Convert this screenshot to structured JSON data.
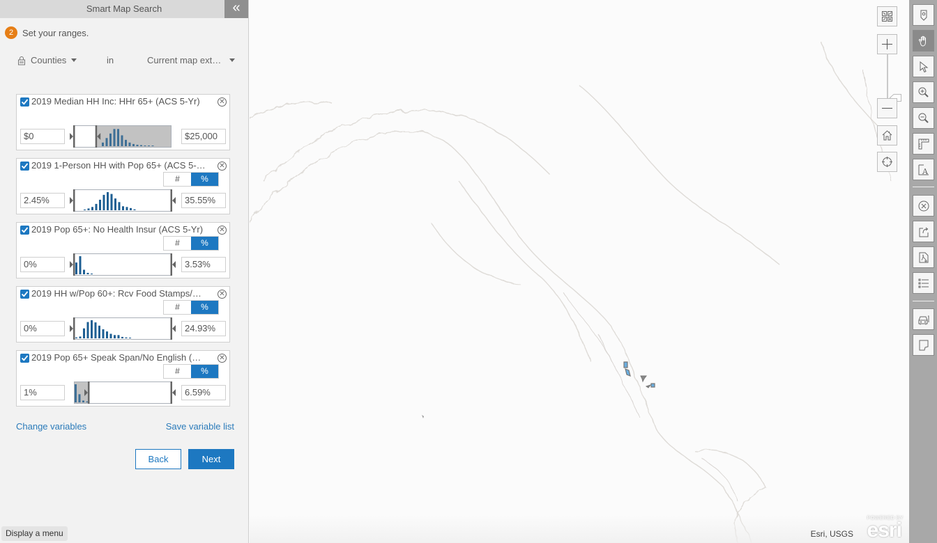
{
  "panel": {
    "title": "Smart Map Search",
    "collapse_icon": "double-chevron-left-icon",
    "step_number": "2",
    "step_text": "Set your ranges.",
    "geography_level": "Counties",
    "geography_connector": "in",
    "extent": "Current map ext…",
    "variables": [
      {
        "title": "2019 Median HH Inc: HHr 65+ (ACS 5-Yr)",
        "checked": true,
        "has_toggle": false,
        "min": "$0",
        "max": "$25,000",
        "selected_range_fraction": [
          0.0,
          0.23
        ],
        "histogram": [
          0.2,
          0.45,
          0.7,
          0.95,
          0.95,
          0.6,
          0.35,
          0.2,
          0.12,
          0.08,
          0.06,
          0.04,
          0.03,
          0.02
        ]
      },
      {
        "title": "2019 1-Person HH with Pop 65+ (ACS 5-…",
        "checked": true,
        "has_toggle": true,
        "toggle": {
          "count_label": "#",
          "percent_label": "%",
          "selected": "%"
        },
        "min": "2.45%",
        "max": "35.55%",
        "selected_range_fraction": [
          0.0,
          1.0
        ],
        "histogram": [
          0.04,
          0.1,
          0.18,
          0.35,
          0.58,
          0.85,
          1.0,
          0.9,
          0.65,
          0.45,
          0.22,
          0.18,
          0.12,
          0.05
        ]
      },
      {
        "title": "2019 Pop 65+: No Health Insur (ACS 5-Yr)",
        "checked": true,
        "has_toggle": true,
        "toggle": {
          "count_label": "#",
          "percent_label": "%",
          "selected": "%"
        },
        "min": "0%",
        "max": "3.53%",
        "selected_range_fraction": [
          0.0,
          1.0
        ],
        "histogram": [
          0.65,
          1.0,
          0.25,
          0.08,
          0.04
        ]
      },
      {
        "title": "2019 HH w/Pop 60+: Rcv Food Stamps/…",
        "checked": true,
        "has_toggle": true,
        "toggle": {
          "count_label": "#",
          "percent_label": "%",
          "selected": "%"
        },
        "min": "0%",
        "max": "24.93%",
        "selected_range_fraction": [
          0.0,
          1.0
        ],
        "histogram": [
          0.05,
          0.1,
          0.55,
          0.9,
          1.0,
          0.88,
          0.7,
          0.5,
          0.38,
          0.25,
          0.18,
          0.18,
          0.08,
          0.05,
          0.03
        ]
      },
      {
        "title": "2019 Pop 65+ Speak Span/No English (…",
        "checked": true,
        "has_toggle": true,
        "toggle": {
          "count_label": "#",
          "percent_label": "%",
          "selected": "%"
        },
        "min": "1%",
        "max": "6.59%",
        "selected_range_fraction": [
          0.15,
          1.0
        ],
        "histogram": [
          1.0,
          0.45,
          0.1,
          0.05
        ]
      }
    ],
    "change_variables_label": "Change variables",
    "save_variable_list_label": "Save variable list",
    "back_label": "Back",
    "next_label": "Next",
    "display_menu_label": "Display a menu"
  },
  "map": {
    "attribution": "Esri, USGS",
    "logo_powered_by": "POWERED BY",
    "logo_wordmark": "esri",
    "controls": [
      {
        "name": "basemap-gallery-button",
        "icon": "basemap-grid-icon"
      },
      {
        "name": "zoom-in-button",
        "icon": "plus-icon"
      },
      {
        "name": "zoom-out-button",
        "icon": "minus-icon"
      },
      {
        "name": "home-button",
        "icon": "home-icon"
      },
      {
        "name": "locate-button",
        "icon": "crosshair-icon"
      }
    ],
    "highlight_color": "#6aaee0"
  },
  "toolbar": {
    "tools": [
      {
        "name": "pin-tool",
        "icon": "map-pin-icon",
        "active": false
      },
      {
        "name": "pan-tool",
        "icon": "hand-icon",
        "active": true
      },
      {
        "name": "select-tool",
        "icon": "cursor-arrow-icon",
        "active": false
      },
      {
        "name": "zoom-in-tool",
        "icon": "zoom-in-magnifier-icon",
        "active": false
      },
      {
        "name": "zoom-out-tool",
        "icon": "zoom-out-magnifier-icon",
        "active": false
      },
      {
        "name": "measure-tool",
        "icon": "ruler-icon",
        "active": false
      },
      {
        "name": "annotate-tool",
        "icon": "text-annotation-icon",
        "active": false
      },
      {
        "name": "clear-tool",
        "icon": "circle-x-icon",
        "active": false
      },
      {
        "name": "share-tool",
        "icon": "share-export-icon",
        "active": false
      },
      {
        "name": "pdf-tool",
        "icon": "pdf-add-icon",
        "active": false
      },
      {
        "name": "legend-tool",
        "icon": "list-icon",
        "active": false
      },
      {
        "name": "drive-time-tool",
        "icon": "car-icon",
        "active": false
      },
      {
        "name": "notes-tool",
        "icon": "note-icon",
        "active": false
      }
    ]
  },
  "colors": {
    "accent": "#1d78c1",
    "step_badge": "#e67e16",
    "histogram_bar": "#1e5f93",
    "histogram_out_of_range": "#c2c2c2",
    "link": "#2b7bba"
  }
}
